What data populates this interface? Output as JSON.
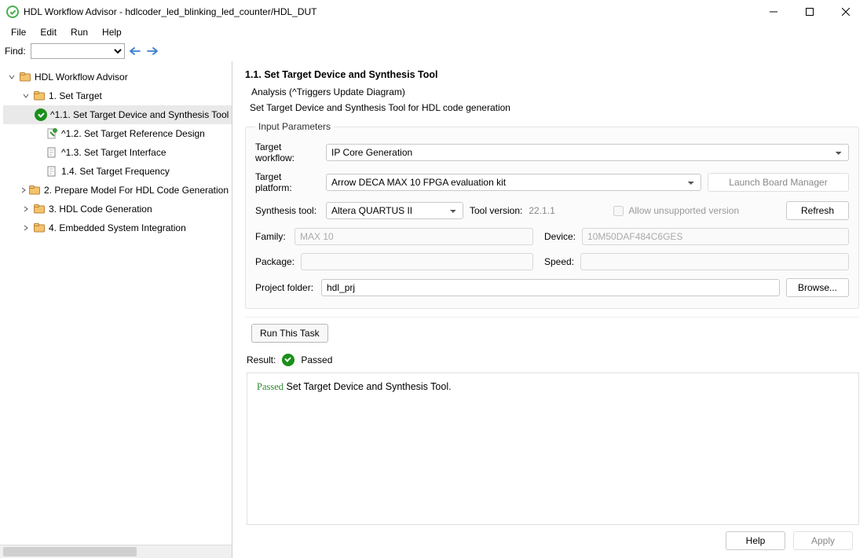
{
  "window": {
    "title": "HDL Workflow Advisor - hdlcoder_led_blinking_led_counter/HDL_DUT"
  },
  "menu": {
    "items": [
      "File",
      "Edit",
      "Run",
      "Help"
    ]
  },
  "find": {
    "label": "Find:",
    "value": ""
  },
  "tree": {
    "root": "HDL Workflow Advisor",
    "n1": "1. Set Target",
    "n11": "^1.1. Set Target Device and Synthesis Tool",
    "n12": "^1.2. Set Target Reference Design",
    "n13": "^1.3. Set Target Interface",
    "n14": "1.4. Set Target Frequency",
    "n2": "2. Prepare Model For HDL Code Generation",
    "n3": "3. HDL Code Generation",
    "n4": "4. Embedded System Integration"
  },
  "page": {
    "title": "1.1. Set Target Device and Synthesis Tool",
    "analysis": "Analysis (^Triggers Update Diagram)",
    "description": "Set Target Device and Synthesis Tool for HDL code generation",
    "legend": "Input Parameters",
    "labels": {
      "target_workflow": "Target workflow:",
      "target_platform": "Target platform:",
      "synthesis_tool": "Synthesis tool:",
      "tool_version": "Tool version:",
      "allow_unsupported": "Allow unsupported version",
      "family": "Family:",
      "device": "Device:",
      "package": "Package:",
      "speed": "Speed:",
      "project_folder": "Project folder:"
    },
    "values": {
      "target_workflow": "IP Core Generation",
      "target_platform": "Arrow DECA MAX 10 FPGA evaluation kit",
      "synthesis_tool": "Altera QUARTUS II",
      "tool_version": "22.1.1",
      "allow_unsupported": false,
      "family": "MAX 10",
      "device": "10M50DAF484C6GES",
      "package": "",
      "speed": "",
      "project_folder": "hdl_prj"
    },
    "buttons": {
      "launch_board_manager": "Launch Board Manager",
      "refresh": "Refresh",
      "browse": "Browse...",
      "run_this_task": "Run This Task"
    },
    "result_label": "Result:",
    "result_status": "Passed",
    "log_passed": "Passed",
    "log_rest": " Set Target Device and Synthesis Tool."
  },
  "footer": {
    "help": "Help",
    "apply": "Apply"
  }
}
